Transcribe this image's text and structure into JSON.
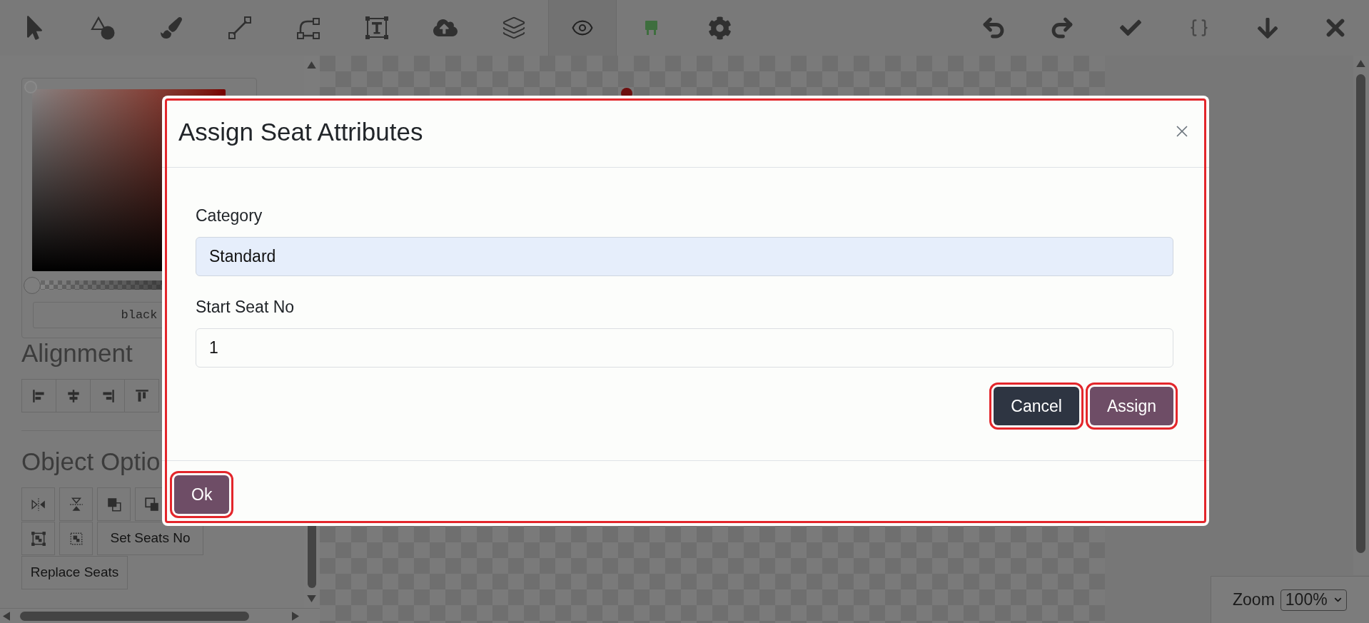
{
  "toolbar": {
    "tools": [
      {
        "selected": false
      },
      {
        "selected": false
      },
      {
        "selected": false
      },
      {
        "selected": false
      },
      {
        "selected": false
      },
      {
        "selected": false
      },
      {
        "selected": false
      },
      {
        "selected": false
      },
      {
        "selected": true
      },
      {
        "selected": false
      },
      {
        "selected": false
      }
    ]
  },
  "side_panel": {
    "color_picker": {
      "value": "black",
      "opacity": {
        "level": 0
      }
    },
    "alignment": {
      "heading": "Alignment"
    },
    "object_options": {
      "heading": "Object Optio",
      "buttons": [
        "Set Seats No",
        "Replace Seats"
      ]
    }
  },
  "dialog": {
    "title": "Assign Seat Attributes",
    "highlighted": true,
    "fields": [
      {
        "label": "Category",
        "value": "Standard",
        "autofilled": true
      },
      {
        "label": "Start Seat No",
        "value": "1",
        "autofilled": false
      }
    ],
    "buttons": [
      {
        "label": "Cancel",
        "kind": "secondary",
        "highlighted": true
      },
      {
        "label": "Assign",
        "kind": "primary",
        "highlighted": true
      }
    ],
    "footer_buttons": [
      {
        "label": "Ok",
        "kind": "primary",
        "highlighted": true
      }
    ]
  },
  "zoom": {
    "label": "Zoom",
    "value": "100%"
  }
}
